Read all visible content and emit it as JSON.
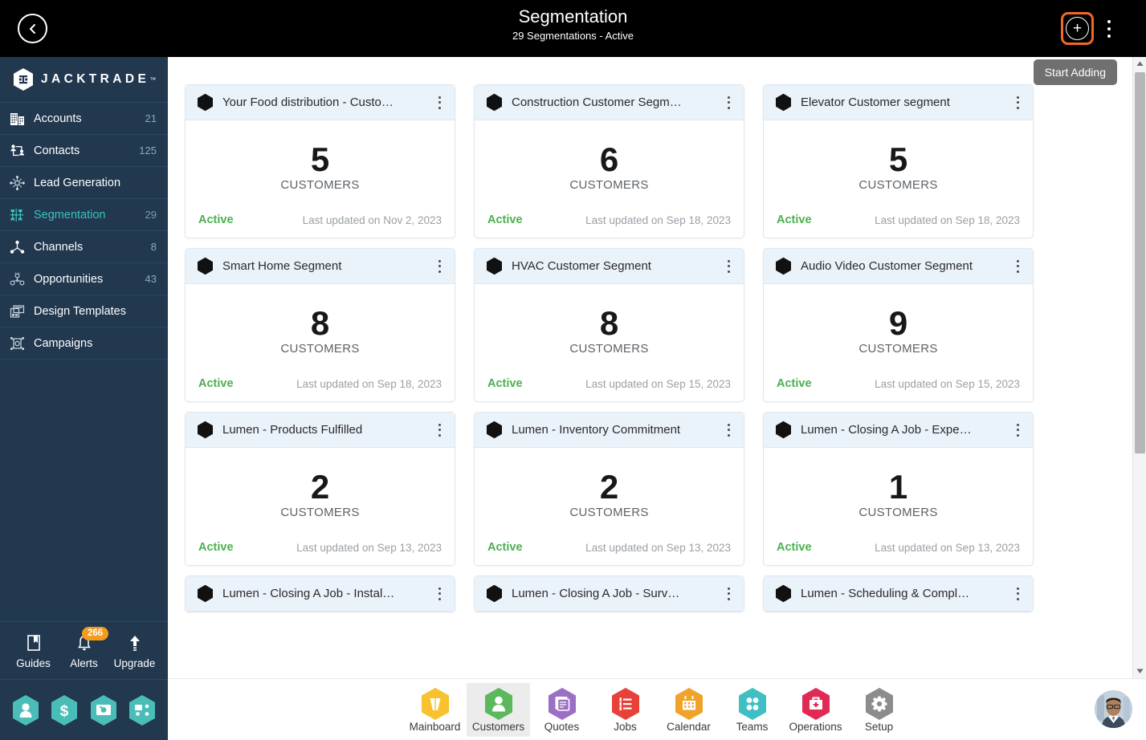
{
  "header": {
    "back_icon": "chevron-left-circle-icon",
    "title": "Segmentation",
    "subtitle": "29 Segmentations - Active",
    "add_icon": "plus-circle-icon",
    "more_icon": "kebab-menu-icon",
    "tooltip": "Start Adding",
    "accent_color": "#f4672a",
    "background_color": "#000000"
  },
  "sidebar": {
    "brand": "JACKTRADE",
    "brand_tm": "™",
    "background_color": "#21384f",
    "active_color": "#3cc3bd",
    "items": [
      {
        "label": "Accounts",
        "count": "21",
        "icon": "building-icon",
        "active": false
      },
      {
        "label": "Contacts",
        "count": "125",
        "icon": "contacts-icon",
        "active": false
      },
      {
        "label": "Lead Generation",
        "count": "",
        "icon": "lead-generation-icon",
        "active": false
      },
      {
        "label": "Segmentation",
        "count": "29",
        "icon": "segmentation-icon",
        "active": true
      },
      {
        "label": "Channels",
        "count": "8",
        "icon": "channels-icon",
        "active": false
      },
      {
        "label": "Opportunities",
        "count": "43",
        "icon": "opportunities-icon",
        "active": false
      },
      {
        "label": "Design Templates",
        "count": "",
        "icon": "design-templates-icon",
        "active": false
      },
      {
        "label": "Campaigns",
        "count": "",
        "icon": "campaigns-icon",
        "active": false
      }
    ],
    "footer": [
      {
        "label": "Guides",
        "icon": "book-icon",
        "badge": ""
      },
      {
        "label": "Alerts",
        "icon": "bell-icon",
        "badge": "266"
      },
      {
        "label": "Upgrade",
        "icon": "arrow-up-icon",
        "badge": ""
      }
    ],
    "quick_actions": [
      {
        "icon": "person-hex-icon"
      },
      {
        "icon": "dollar-hex-icon"
      },
      {
        "icon": "payment-hex-icon"
      },
      {
        "icon": "workflow-hex-icon"
      }
    ],
    "badge_color": "#f59b1c"
  },
  "main": {
    "card_icon": "hexagon-icon",
    "card_menu_icon": "kebab-menu-icon",
    "metric_label": "CUSTOMERS",
    "status_color": "#4caf50",
    "cards": [
      {
        "name": "Your Food distribution - Custo…",
        "count": "5",
        "unit": "CUSTOMERS",
        "status": "Active",
        "updated": "Last updated on Nov 2, 2023"
      },
      {
        "name": "Construction Customer Segm…",
        "count": "6",
        "unit": "CUSTOMERS",
        "status": "Active",
        "updated": "Last updated on Sep 18, 2023"
      },
      {
        "name": "Elevator Customer segment",
        "count": "5",
        "unit": "CUSTOMERS",
        "status": "Active",
        "updated": "Last updated on Sep 18, 2023"
      },
      {
        "name": "Smart Home Segment",
        "count": "8",
        "unit": "CUSTOMERS",
        "status": "Active",
        "updated": "Last updated on Sep 18, 2023"
      },
      {
        "name": "HVAC Customer Segment",
        "count": "8",
        "unit": "CUSTOMERS",
        "status": "Active",
        "updated": "Last updated on Sep 15, 2023"
      },
      {
        "name": "Audio Video Customer Segment",
        "count": "9",
        "unit": "CUSTOMERS",
        "status": "Active",
        "updated": "Last updated on Sep 15, 2023"
      },
      {
        "name": "Lumen - Products Fulfilled",
        "count": "2",
        "unit": "CUSTOMERS",
        "status": "Active",
        "updated": "Last updated on Sep 13, 2023"
      },
      {
        "name": "Lumen - Inventory Commitment",
        "count": "2",
        "unit": "CUSTOMERS",
        "status": "Active",
        "updated": "Last updated on Sep 13, 2023"
      },
      {
        "name": "Lumen - Closing A Job - Expe…",
        "count": "1",
        "unit": "CUSTOMERS",
        "status": "Active",
        "updated": "Last updated on Sep 13, 2023"
      }
    ],
    "partial_cards": [
      {
        "name": "Lumen - Closing A Job - Instal…"
      },
      {
        "name": "Lumen - Closing A Job - Surv…"
      },
      {
        "name": "Lumen - Scheduling & Compl…"
      }
    ]
  },
  "bottom_nav": {
    "items": [
      {
        "label": "Mainboard",
        "icon": "mainboard-icon",
        "color": "#f7c22e",
        "selected": false
      },
      {
        "label": "Customers",
        "icon": "customers-icon",
        "color": "#5cb85c",
        "selected": true
      },
      {
        "label": "Quotes",
        "icon": "quotes-icon",
        "color": "#9b6fc4",
        "selected": false
      },
      {
        "label": "Jobs",
        "icon": "jobs-icon",
        "color": "#e8413a",
        "selected": false
      },
      {
        "label": "Calendar",
        "icon": "calendar-icon",
        "color": "#f0a32a",
        "selected": false
      },
      {
        "label": "Teams",
        "icon": "teams-icon",
        "color": "#3fbfc4",
        "selected": false
      },
      {
        "label": "Operations",
        "icon": "operations-icon",
        "color": "#e02a55",
        "selected": false
      },
      {
        "label": "Setup",
        "icon": "setup-icon",
        "color": "#8c8c8c",
        "selected": false
      }
    ],
    "avatar": "user-avatar"
  },
  "scrollbar": {
    "up_icon": "caret-up-icon",
    "down_icon": "caret-down-icon"
  }
}
